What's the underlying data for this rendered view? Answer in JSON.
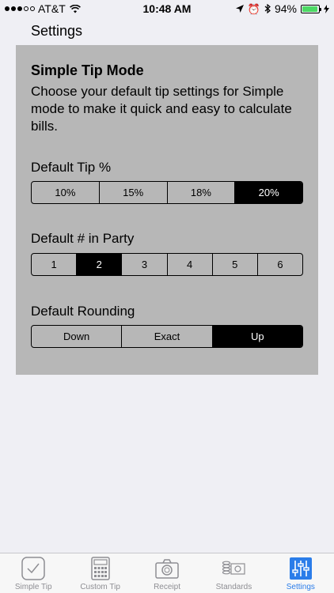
{
  "status": {
    "carrier": "AT&T",
    "time": "10:48 AM",
    "battery": "94%",
    "battery_color": "#4cd964"
  },
  "nav": {
    "title": "Settings"
  },
  "panel": {
    "title": "Simple Tip Mode",
    "description": "Choose your default tip settings for Simple mode to make it quick and easy to calculate bills.",
    "tip": {
      "label": "Default Tip %",
      "options": [
        "10%",
        "15%",
        "18%",
        "20%"
      ],
      "selected": "20%"
    },
    "party": {
      "label": "Default # in Party",
      "options": [
        "1",
        "2",
        "3",
        "4",
        "5",
        "6"
      ],
      "selected": "2"
    },
    "rounding": {
      "label": "Default Rounding",
      "options": [
        "Down",
        "Exact",
        "Up"
      ],
      "selected": "Up"
    }
  },
  "tabs": [
    {
      "label": "Simple Tip",
      "icon": "checkmark-icon"
    },
    {
      "label": "Custom Tip",
      "icon": "calculator-icon"
    },
    {
      "label": "Receipt",
      "icon": "camera-icon"
    },
    {
      "label": "Standards",
      "icon": "money-icon"
    },
    {
      "label": "Settings",
      "icon": "sliders-icon",
      "active": true
    }
  ],
  "accent": "#2b7de9"
}
